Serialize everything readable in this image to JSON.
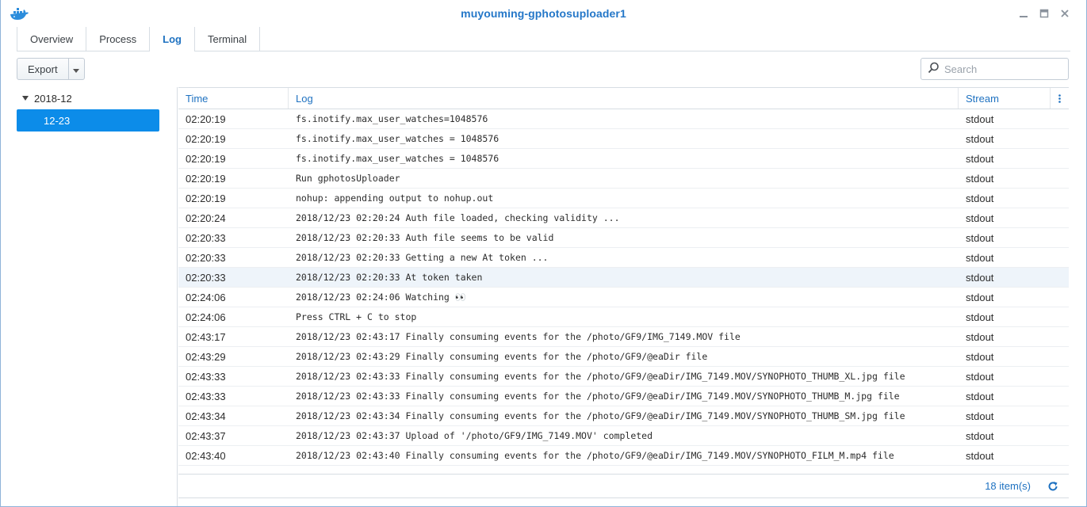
{
  "window": {
    "title": "muyouming-gphotosuploader1",
    "icon": "docker-whale-icon",
    "accent_color": "#2477c8"
  },
  "tabs": [
    {
      "label": "Overview",
      "active": false
    },
    {
      "label": "Process",
      "active": false
    },
    {
      "label": "Log",
      "active": true
    },
    {
      "label": "Terminal",
      "active": false
    }
  ],
  "toolbar": {
    "export_label": "Export",
    "search_placeholder": "Search"
  },
  "tree": {
    "group_label": "2018-12",
    "selected_item": "12-23",
    "selected_color": "#0c8ce9"
  },
  "grid": {
    "columns": {
      "time": "Time",
      "log": "Log",
      "stream": "Stream"
    },
    "rows": [
      {
        "time": "02:20:19",
        "log": "fs.inotify.max_user_watches=1048576",
        "stream": "stdout"
      },
      {
        "time": "02:20:19",
        "log": "fs.inotify.max_user_watches = 1048576",
        "stream": "stdout"
      },
      {
        "time": "02:20:19",
        "log": "fs.inotify.max_user_watches = 1048576",
        "stream": "stdout"
      },
      {
        "time": "02:20:19",
        "log": "Run gphotosUploader",
        "stream": "stdout"
      },
      {
        "time": "02:20:19",
        "log": "nohup: appending output to nohup.out",
        "stream": "stdout"
      },
      {
        "time": "02:20:24",
        "log": "2018/12/23 02:20:24 Auth file loaded, checking validity ...",
        "stream": "stdout"
      },
      {
        "time": "02:20:33",
        "log": "2018/12/23 02:20:33 Auth file seems to be valid",
        "stream": "stdout"
      },
      {
        "time": "02:20:33",
        "log": "2018/12/23 02:20:33 Getting a new At token ...",
        "stream": "stdout"
      },
      {
        "time": "02:20:33",
        "log": "2018/12/23 02:20:33 At token taken",
        "stream": "stdout",
        "highlight": true
      },
      {
        "time": "02:24:06",
        "log": "2018/12/23 02:24:06 Watching 👀",
        "stream": "stdout"
      },
      {
        "time": "02:24:06",
        "log": "Press CTRL + C to stop",
        "stream": "stdout"
      },
      {
        "time": "02:43:17",
        "log": "2018/12/23 02:43:17 Finally consuming events for the /photo/GF9/IMG_7149.MOV file",
        "stream": "stdout"
      },
      {
        "time": "02:43:29",
        "log": "2018/12/23 02:43:29 Finally consuming events for the /photo/GF9/@eaDir file",
        "stream": "stdout"
      },
      {
        "time": "02:43:33",
        "log": "2018/12/23 02:43:33 Finally consuming events for the /photo/GF9/@eaDir/IMG_7149.MOV/SYNOPHOTO_THUMB_XL.jpg file",
        "stream": "stdout"
      },
      {
        "time": "02:43:33",
        "log": "2018/12/23 02:43:33 Finally consuming events for the /photo/GF9/@eaDir/IMG_7149.MOV/SYNOPHOTO_THUMB_M.jpg file",
        "stream": "stdout"
      },
      {
        "time": "02:43:34",
        "log": "2018/12/23 02:43:34 Finally consuming events for the /photo/GF9/@eaDir/IMG_7149.MOV/SYNOPHOTO_THUMB_SM.jpg file",
        "stream": "stdout"
      },
      {
        "time": "02:43:37",
        "log": "2018/12/23 02:43:37 Upload of '/photo/GF9/IMG_7149.MOV' completed",
        "stream": "stdout"
      },
      {
        "time": "02:43:40",
        "log": "2018/12/23 02:43:40 Finally consuming events for the /photo/GF9/@eaDir/IMG_7149.MOV/SYNOPHOTO_FILM_M.mp4 file",
        "stream": "stdout"
      }
    ],
    "item_count": "18 item(s)"
  }
}
